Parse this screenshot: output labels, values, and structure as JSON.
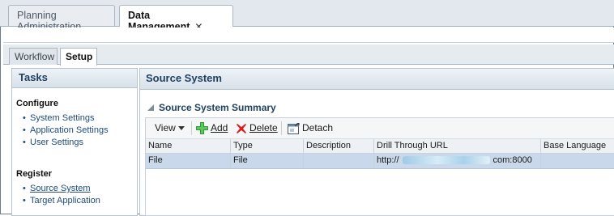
{
  "app_tabs": [
    {
      "label": "Planning Administration",
      "active": false
    },
    {
      "label": "Data Management",
      "active": true,
      "close_glyph": "✕"
    }
  ],
  "sub_tabs": [
    {
      "label": "Workflow",
      "active": false
    },
    {
      "label": "Setup",
      "active": true
    }
  ],
  "tasks_panel": {
    "title": "Tasks",
    "groups": [
      {
        "title": "Configure",
        "items": [
          "System Settings",
          "Application Settings",
          "User Settings"
        ]
      },
      {
        "title": "Register",
        "items": [
          "Source System",
          "Target Application"
        ]
      }
    ],
    "selected_item": "Source System"
  },
  "main_panel": {
    "title": "Source System",
    "summary_title": "Source System Summary",
    "actions": {
      "view": "View",
      "add": "Add",
      "delete": "Delete",
      "detach": "Detach"
    },
    "icons": {
      "view": "dropdown-caret-icon",
      "add": "add-plus-icon",
      "delete": "delete-x-icon",
      "detach": "detach-window-icon"
    },
    "columns": [
      "Name",
      "Type",
      "Description",
      "Drill Through URL",
      "Base Language"
    ],
    "rows": [
      {
        "name": "File",
        "type": "File",
        "description": "",
        "url_prefix": "http://",
        "url_suffix": "com:8000",
        "base_language": ""
      }
    ]
  },
  "colors": {
    "accent_text": "#1f3f5f",
    "link": "#1f4b7a",
    "selected_row": "#c9d8ea",
    "add_icon": "#2e9b2e",
    "delete_icon": "#d6201c"
  }
}
